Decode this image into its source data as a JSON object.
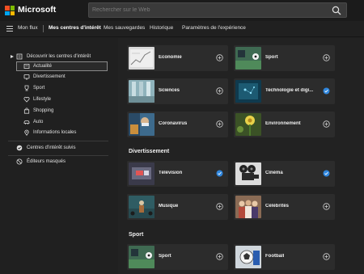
{
  "header": {
    "brand": "Microsoft",
    "search_placeholder": "Rechercher sur le Web"
  },
  "nav": {
    "items": [
      {
        "label": "Mon flux"
      },
      {
        "label": "Mes centres d'intérêt"
      },
      {
        "label": "Mes sauvegardes"
      },
      {
        "label": "Historique"
      },
      {
        "label": "Paramètres de l'expérience"
      }
    ],
    "active_index": 1
  },
  "sidebar": {
    "discover_label": "Découvrir les centres d'intérêt",
    "items": [
      {
        "label": "Actualité",
        "icon": "newspaper-icon"
      },
      {
        "label": "Divertissement",
        "icon": "tv-icon"
      },
      {
        "label": "Sport",
        "icon": "trophy-icon"
      },
      {
        "label": "Lifestyle",
        "icon": "heart-icon"
      },
      {
        "label": "Shopping",
        "icon": "bag-icon"
      },
      {
        "label": "Auto",
        "icon": "car-icon"
      },
      {
        "label": "Informations locales",
        "icon": "pin-icon"
      }
    ],
    "followed_label": "Centres d'intérêt suivis",
    "hidden_label": "Éditeurs masqués"
  },
  "main": {
    "sections": [
      {
        "title": "",
        "cards": [
          {
            "label": "Économie",
            "state": "add"
          },
          {
            "label": "Sport",
            "state": "add"
          },
          {
            "label": "Sciences",
            "state": "add"
          },
          {
            "label": "Technologie et digi...",
            "state": "followed"
          },
          {
            "label": "Coronavirus",
            "state": "add"
          },
          {
            "label": "Environnement",
            "state": "add"
          }
        ]
      },
      {
        "title": "Divertissement",
        "cards": [
          {
            "label": "Télévision",
            "state": "followed"
          },
          {
            "label": "Cinéma",
            "state": "followed"
          },
          {
            "label": "Musique",
            "state": "add"
          },
          {
            "label": "Célébrités",
            "state": "add"
          }
        ]
      },
      {
        "title": "Sport",
        "cards": [
          {
            "label": "Sport",
            "state": "add"
          },
          {
            "label": "Football",
            "state": "add"
          }
        ]
      }
    ]
  },
  "colors": {
    "accent": "#2f86dd",
    "background": "#1f1f1f",
    "card": "#2c2c2c"
  }
}
